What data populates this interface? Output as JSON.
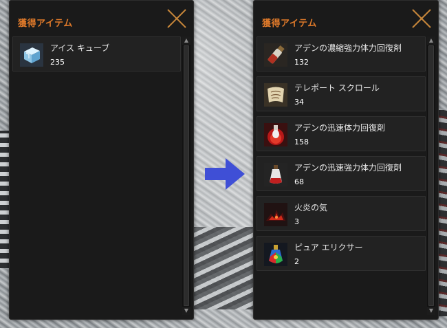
{
  "left_panel": {
    "title": "獲得アイテム",
    "items": [
      {
        "name": "アイス キューブ",
        "count": "235",
        "icon": "ice-cube-icon"
      }
    ]
  },
  "right_panel": {
    "title": "獲得アイテム",
    "items": [
      {
        "name": "アデンの濃縮強力体力回復剤",
        "count": "132",
        "icon": "potion-vial-icon"
      },
      {
        "name": "テレポート スクロール",
        "count": "34",
        "icon": "scroll-icon"
      },
      {
        "name": "アデンの迅速体力回復剤",
        "count": "158",
        "icon": "red-potion-icon"
      },
      {
        "name": "アデンの迅速強力体力回復剤",
        "count": "68",
        "icon": "white-potion-icon"
      },
      {
        "name": "火炎の気",
        "count": "3",
        "icon": "fire-spirit-icon"
      },
      {
        "name": "ピュア エリクサー",
        "count": "2",
        "icon": "elixir-icon"
      }
    ]
  },
  "scroll_glyphs": {
    "up": "▲",
    "down": "▼"
  },
  "colors": {
    "title": "#e07a2a",
    "close": "#c8873a",
    "arrow": "#3f4fd6",
    "panel_bg": "#1a1a1a"
  }
}
